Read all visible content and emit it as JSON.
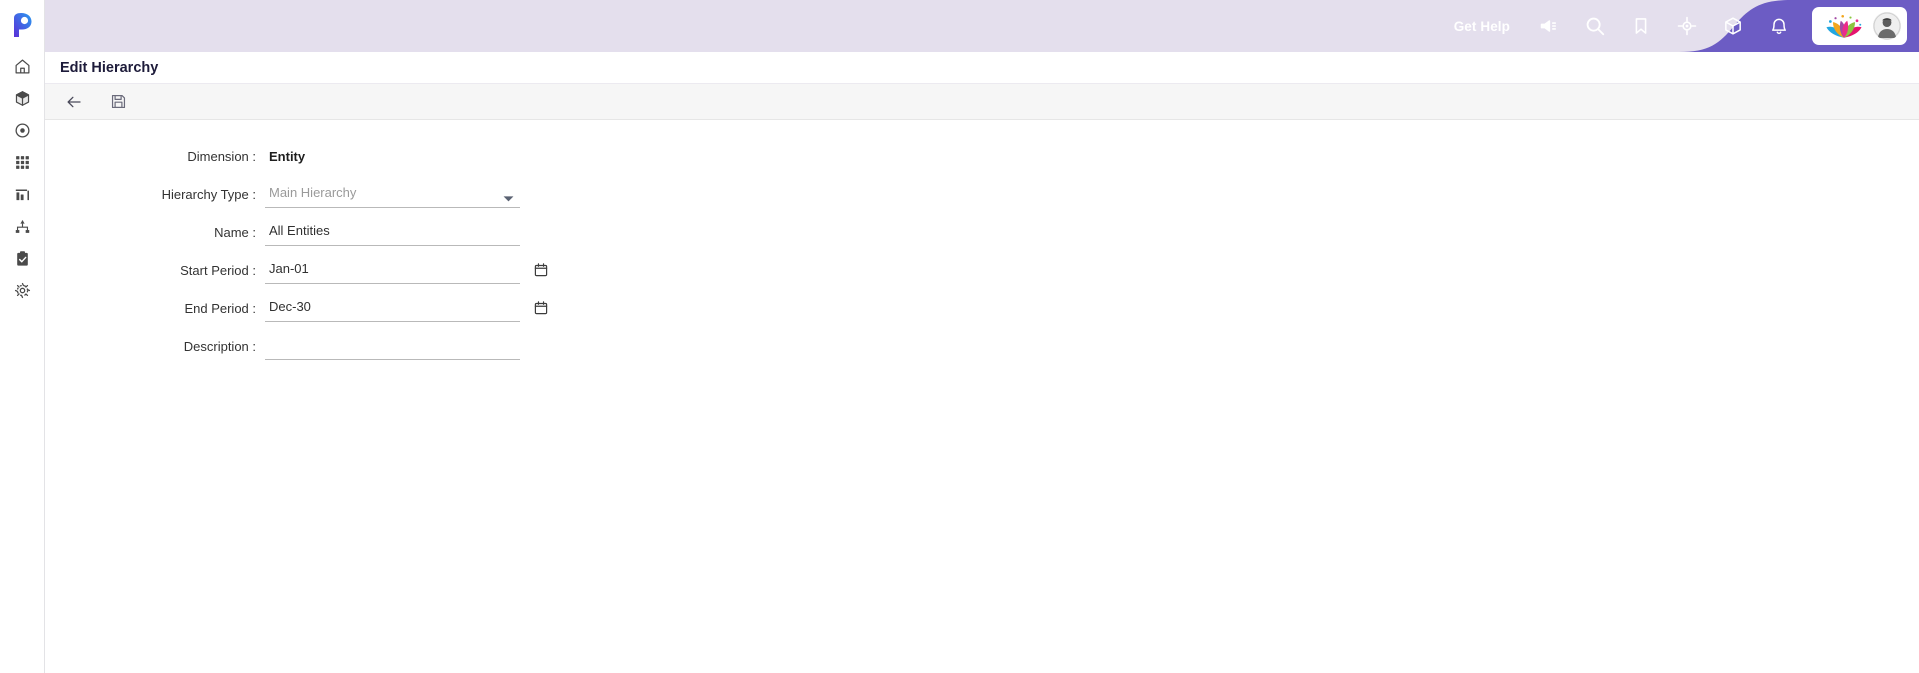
{
  "app": {
    "logo_icon": "p-logo-icon",
    "accent_purple": "#6a5acd",
    "header_bg": "#e4dfed",
    "header_purple": "#6c5cc4"
  },
  "sidebar": {
    "items": [
      {
        "label": "Home",
        "icon": "home-icon"
      },
      {
        "label": "Cube",
        "icon": "cube-icon"
      },
      {
        "label": "Target",
        "icon": "circle-dot-icon"
      },
      {
        "label": "Grid",
        "icon": "grid-icon"
      },
      {
        "label": "Reports",
        "icon": "bar-chart-icon"
      },
      {
        "label": "Hierarchy",
        "icon": "org-chart-icon"
      },
      {
        "label": "Tasks",
        "icon": "clipboard-check-icon"
      },
      {
        "label": "Settings",
        "icon": "gear-icon"
      }
    ]
  },
  "header": {
    "get_help_label": "Get Help",
    "icons": [
      {
        "name": "announcement-icon",
        "title": "Announcements"
      },
      {
        "name": "search-icon",
        "title": "Search"
      },
      {
        "name": "bookmark-icon",
        "title": "Bookmarks"
      },
      {
        "name": "target-crosshair-icon",
        "title": "Navigate"
      },
      {
        "name": "cube-icon",
        "title": "Models"
      },
      {
        "name": "bell-icon",
        "title": "Notifications"
      }
    ],
    "brand_logo_icon": "lotus-logo-icon",
    "avatar_icon": "user-avatar"
  },
  "page": {
    "title": "Edit Hierarchy"
  },
  "toolbar": {
    "back_label": "Back",
    "back_icon": "arrow-left-icon",
    "save_label": "Save",
    "save_icon": "floppy-disk-save-icon"
  },
  "form": {
    "dimension": {
      "label": "Dimension :",
      "value": "Entity"
    },
    "hierarchy_type": {
      "label": "Hierarchy Type :",
      "value": "Main Hierarchy",
      "placeholder": "Main Hierarchy",
      "is_placeholder_style": true,
      "options": [
        "Main Hierarchy"
      ]
    },
    "name": {
      "label": "Name :",
      "value": "All Entities",
      "placeholder": ""
    },
    "start_period": {
      "label": "Start Period :",
      "value": "Jan-01",
      "placeholder": "",
      "calendar_icon": "calendar-icon"
    },
    "end_period": {
      "label": "End Period :",
      "value": "Dec-30",
      "placeholder": "",
      "calendar_icon": "calendar-icon"
    },
    "description": {
      "label": "Description :",
      "value": "",
      "placeholder": ""
    }
  }
}
